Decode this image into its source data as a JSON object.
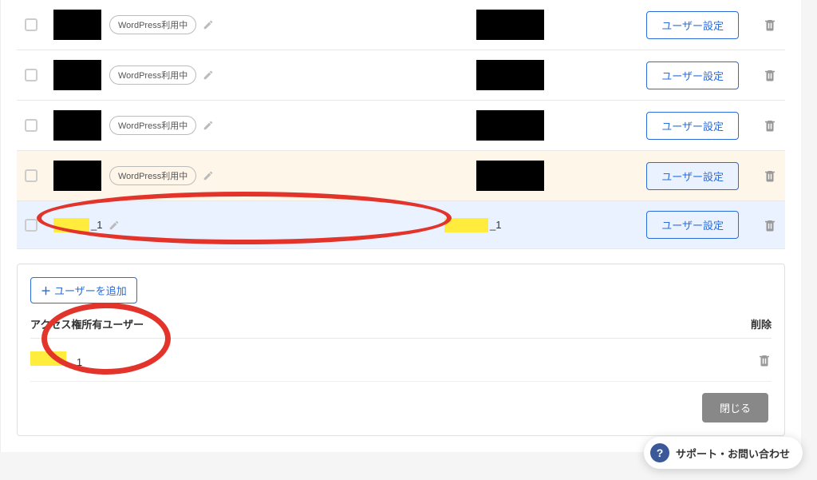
{
  "rows": [
    {
      "badge": "WordPress利用中",
      "userSettings": "ユーザー設定",
      "variant": "normal"
    },
    {
      "badge": "WordPress利用中",
      "userSettings": "ユーザー設定",
      "variant": "normal"
    },
    {
      "badge": "WordPress利用中",
      "userSettings": "ユーザー設定",
      "variant": "normal"
    },
    {
      "badge": "WordPress利用中",
      "userSettings": "ユーザー設定",
      "variant": "orange"
    },
    {
      "badge": "",
      "userSettings": "ユーザー設定",
      "variant": "blue",
      "suffix1": "_1",
      "suffix2": "_1"
    }
  ],
  "panel": {
    "addUser": "ユーザーを追加",
    "headerLeft": "アクセス権所有ユーザー",
    "headerRight": "削除",
    "rowSuffix": "_1",
    "close": "閉じる"
  },
  "support": "サポート・お問い合わせ"
}
